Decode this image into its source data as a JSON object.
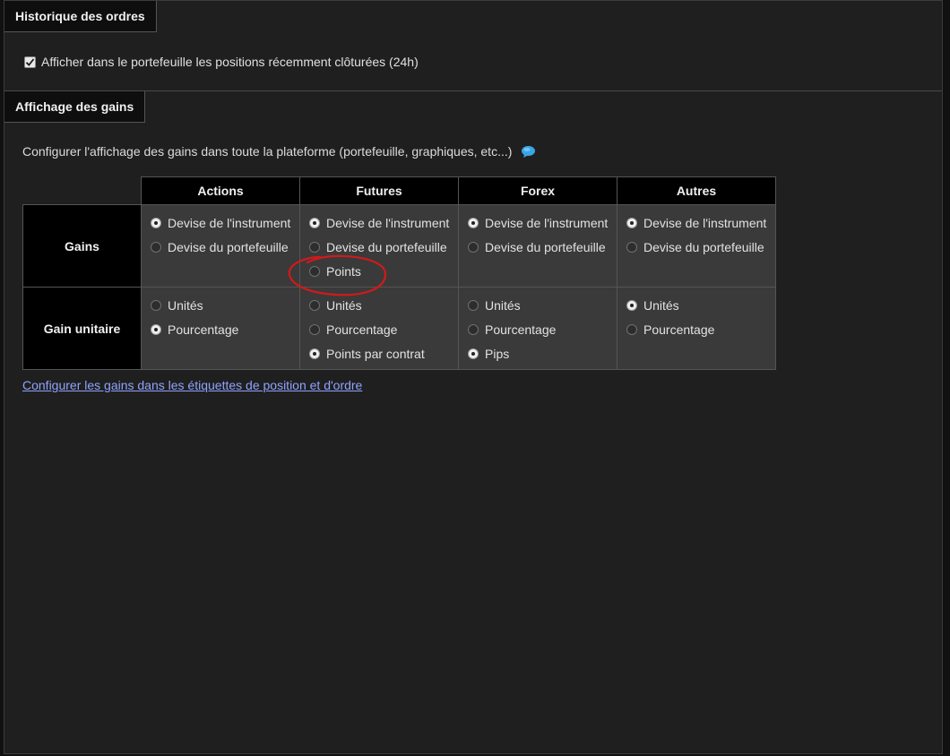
{
  "order_history": {
    "title": "Historique des ordres",
    "show_closed_label": "Afficher dans le portefeuille les positions récemment clôturées (24h)",
    "show_closed_checked": true
  },
  "gains_display": {
    "title": "Affichage des gains",
    "description": "Configurer l'affichage des gains dans toute la plateforme (portefeuille, graphiques, etc...)",
    "info_icon": "speech-bubble-icon",
    "columns": [
      "Actions",
      "Futures",
      "Forex",
      "Autres"
    ],
    "rows": [
      {
        "label": "Gains",
        "cells": [
          [
            {
              "label": "Devise de l'instrument",
              "selected": true
            },
            {
              "label": "Devise du portefeuille",
              "selected": false
            }
          ],
          [
            {
              "label": "Devise de l'instrument",
              "selected": true
            },
            {
              "label": "Devise du portefeuille",
              "selected": false
            },
            {
              "label": "Points",
              "selected": false
            }
          ],
          [
            {
              "label": "Devise de l'instrument",
              "selected": true
            },
            {
              "label": "Devise du portefeuille",
              "selected": false
            }
          ],
          [
            {
              "label": "Devise de l'instrument",
              "selected": true
            },
            {
              "label": "Devise du portefeuille",
              "selected": false
            }
          ]
        ]
      },
      {
        "label": "Gain unitaire",
        "cells": [
          [
            {
              "label": "Unités",
              "selected": false
            },
            {
              "label": "Pourcentage",
              "selected": true
            }
          ],
          [
            {
              "label": "Unités",
              "selected": false
            },
            {
              "label": "Pourcentage",
              "selected": false
            },
            {
              "label": "Points par contrat",
              "selected": true
            }
          ],
          [
            {
              "label": "Unités",
              "selected": false
            },
            {
              "label": "Pourcentage",
              "selected": false
            },
            {
              "label": "Pips",
              "selected": true
            }
          ],
          [
            {
              "label": "Unités",
              "selected": true
            },
            {
              "label": "Pourcentage",
              "selected": false
            }
          ]
        ]
      }
    ],
    "link_text": "Configurer les gains dans les étiquettes de position et d'ordre"
  },
  "colors": {
    "accent_link": "#8fa3ff",
    "annotation": "#d11a1a"
  }
}
